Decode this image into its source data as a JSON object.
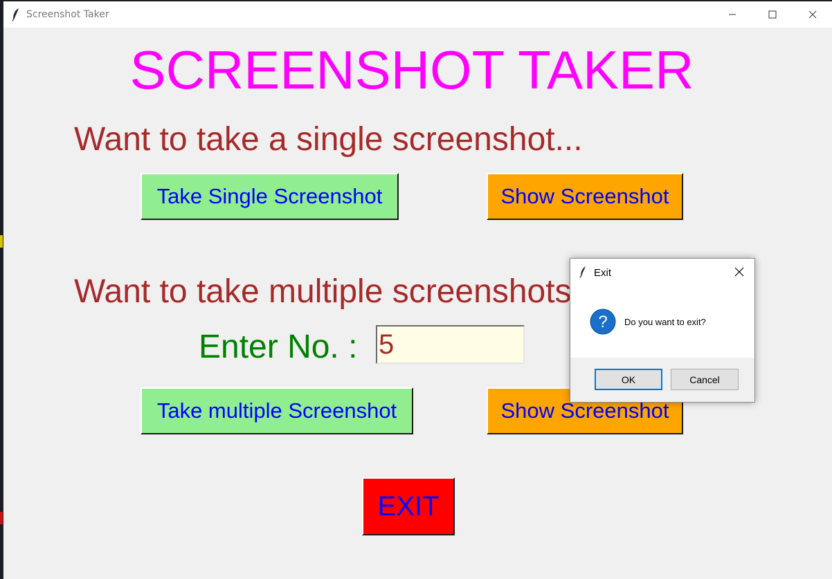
{
  "window": {
    "title": "Screenshot Taker"
  },
  "app": {
    "title": "SCREENSHOT TAKER",
    "single_section": {
      "heading": "Want to take a single screenshot...",
      "take_button": "Take Single Screenshot",
      "show_button": "Show Screenshot"
    },
    "multi_section": {
      "heading": "Want to take multiple screenshots...",
      "enter_label": "Enter No. :",
      "count_value": "5",
      "take_button": "Take multiple Screenshot",
      "show_button": "Show Screenshot"
    },
    "exit_button": "EXIT"
  },
  "dialog": {
    "title": "Exit",
    "message": "Do you want to exit?",
    "ok_label": "OK",
    "cancel_label": "Cancel",
    "icon": "question-icon"
  },
  "colors": {
    "title": "#ff00ff",
    "heading": "#a52a2a",
    "button_text": "#0000ff",
    "green_button": "#90ee90",
    "orange_button": "#ffa500",
    "exit_button": "#ff0000",
    "enter_label": "#008000",
    "input_bg": "#fffde6"
  }
}
